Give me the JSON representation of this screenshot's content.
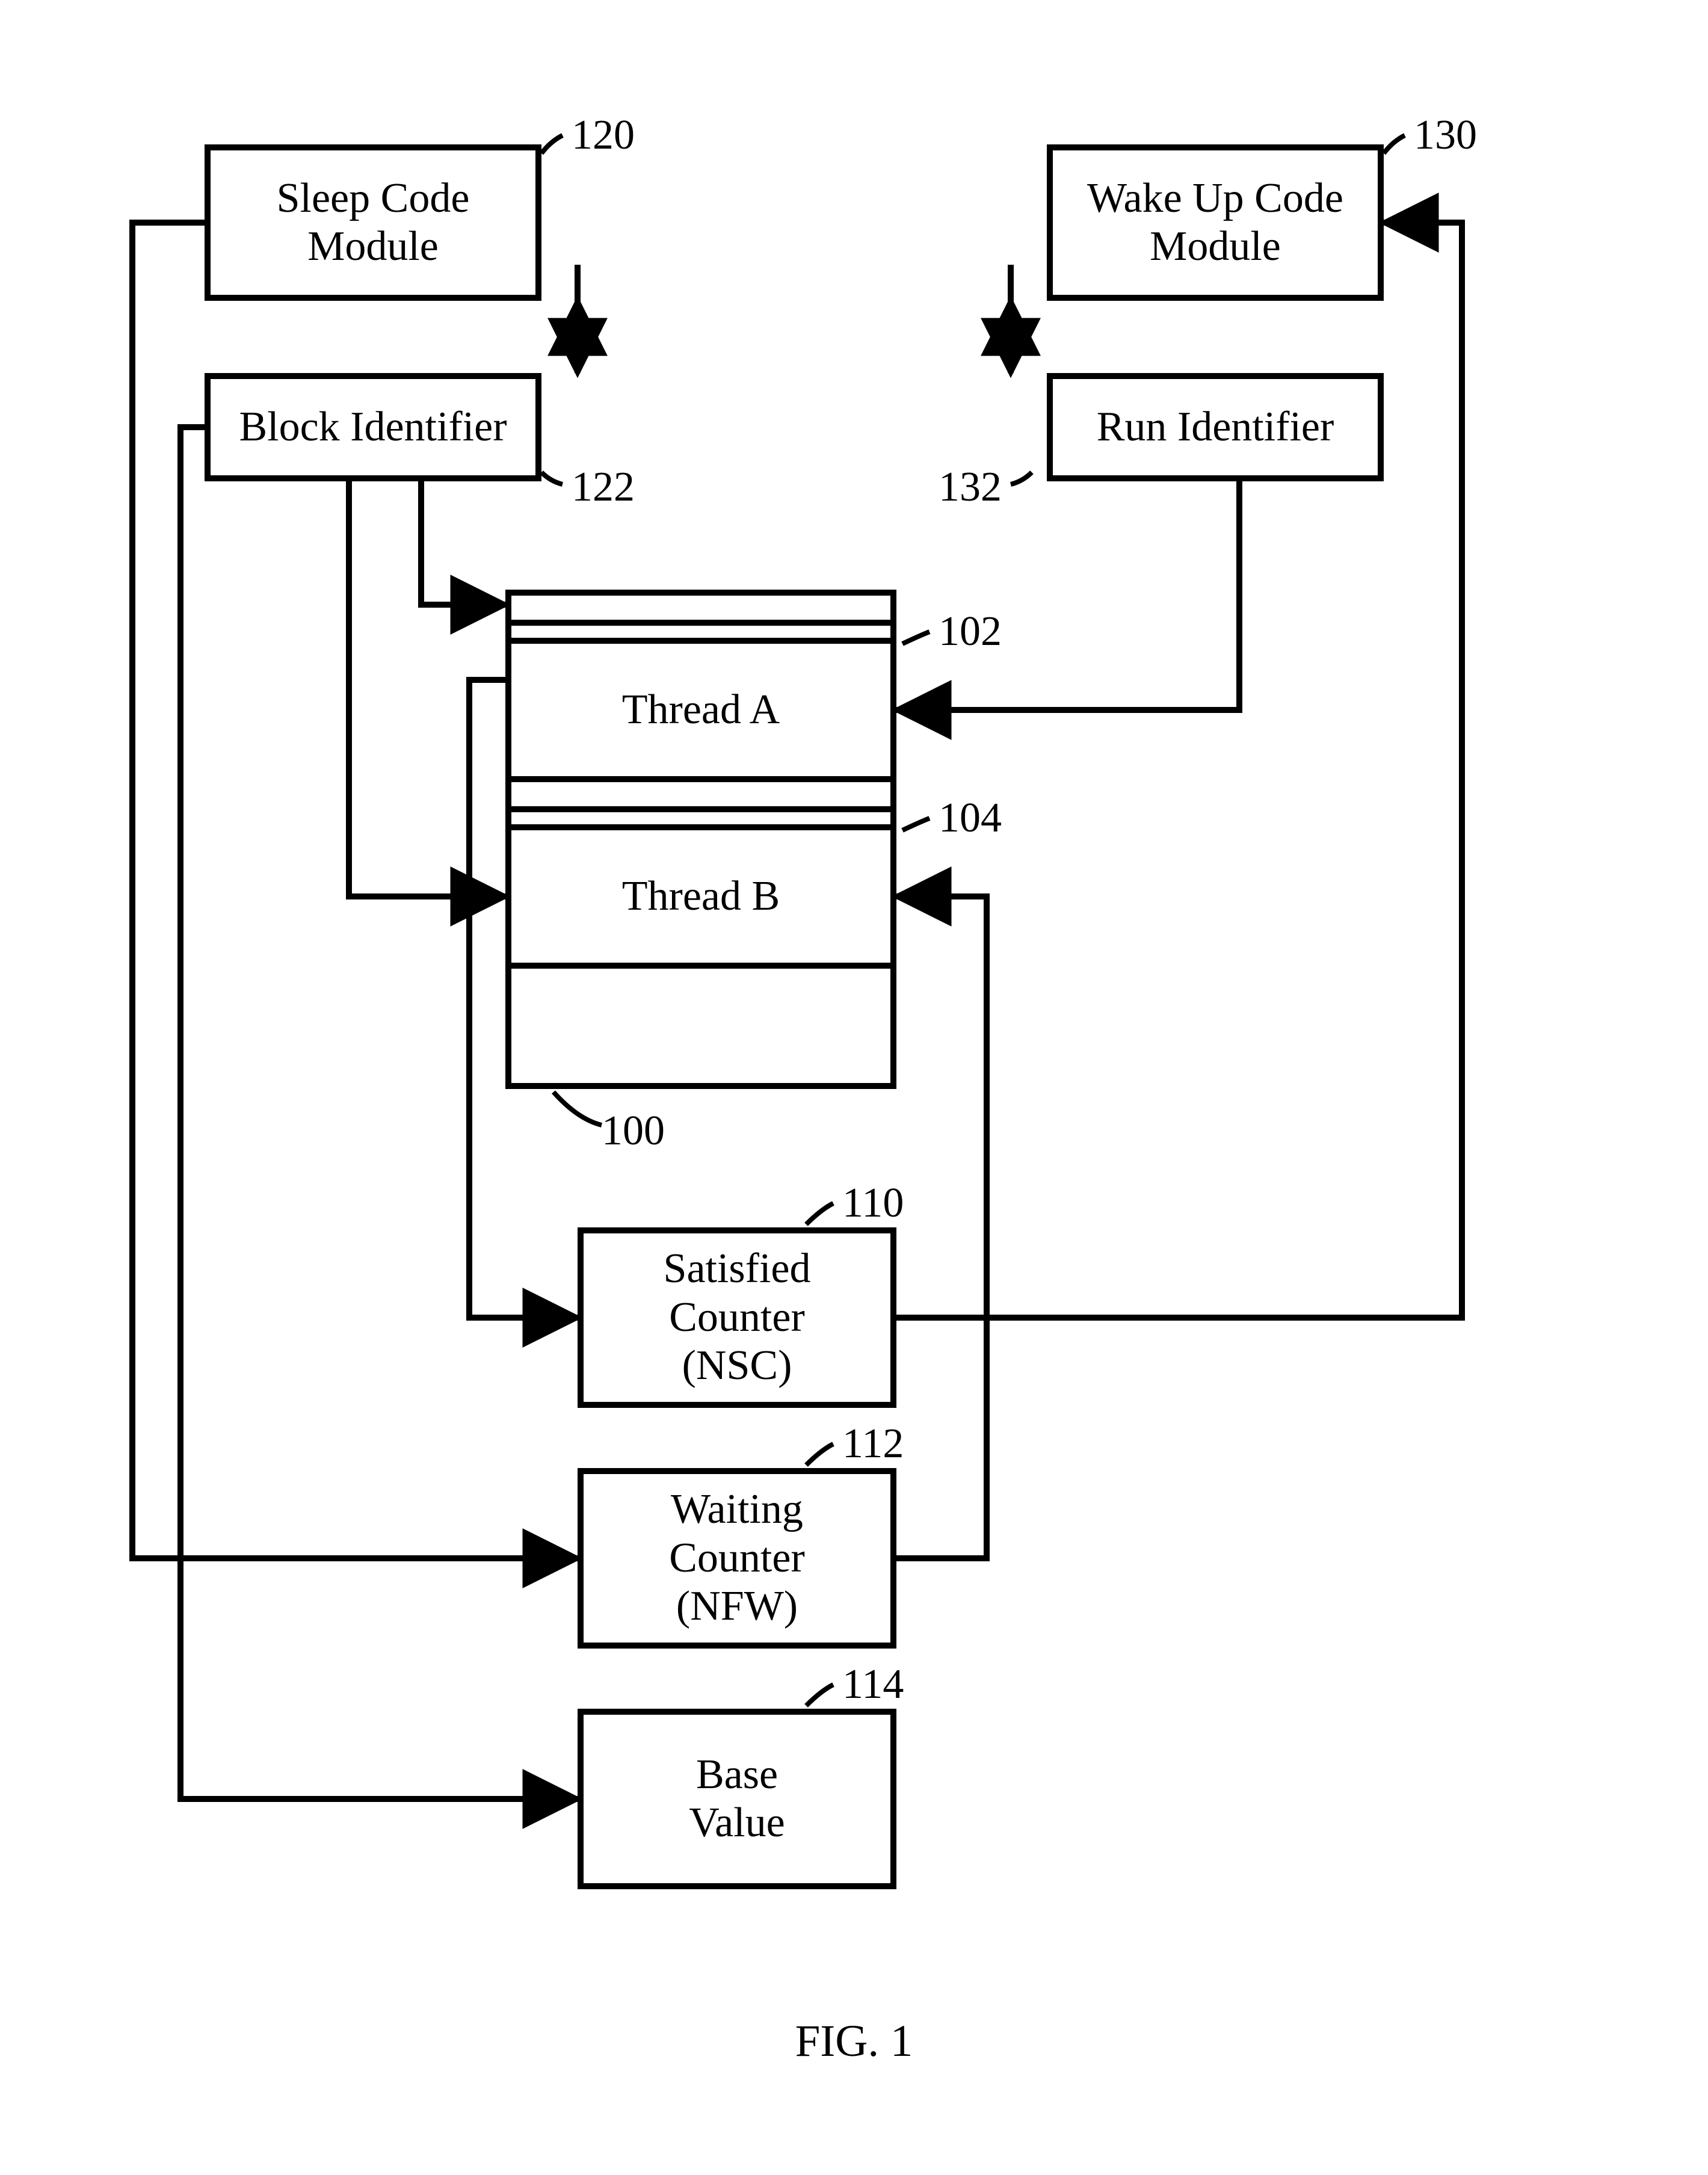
{
  "boxes": {
    "sleep": {
      "text": "Sleep Code\nModule",
      "ref": "120"
    },
    "block": {
      "text": "Block Identifier",
      "ref": "122"
    },
    "wake": {
      "text": "Wake Up Code\nModule",
      "ref": "130"
    },
    "run": {
      "text": "Run Identifier",
      "ref": "132"
    },
    "threadA": {
      "text": "Thread A",
      "ref": "102"
    },
    "threadB": {
      "text": "Thread B",
      "ref": "104"
    },
    "cpu": {
      "text": "",
      "ref": "100"
    },
    "nsc": {
      "text": "Satisfied\nCounter\n(NSC)",
      "ref": "110"
    },
    "nfw": {
      "text": "Waiting\nCounter\n(NFW)",
      "ref": "112"
    },
    "base": {
      "text": "Base\nValue",
      "ref": "114"
    }
  },
  "figure_caption": "FIG. 1"
}
